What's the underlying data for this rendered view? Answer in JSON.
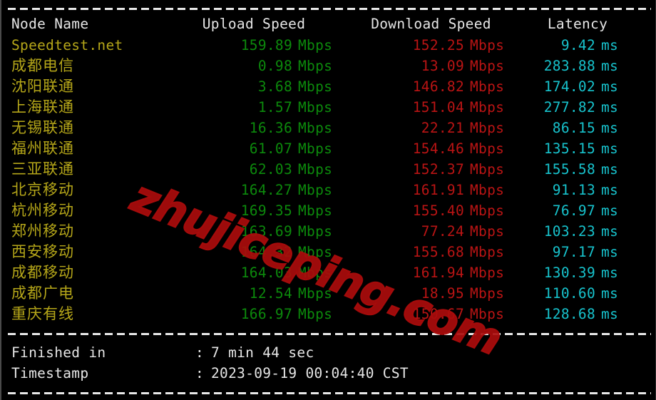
{
  "table": {
    "headers": {
      "node": "Node Name",
      "upload": "Upload Speed",
      "download": "Download Speed",
      "latency": "Latency"
    },
    "units": {
      "speed": "Mbps",
      "latency": "ms"
    },
    "rows": [
      {
        "node": "Speedtest.net",
        "upload": "159.89",
        "download": "152.25",
        "latency": "9.42",
        "cjk": false
      },
      {
        "node": "成都电信",
        "upload": "0.98",
        "download": "13.09",
        "latency": "283.88",
        "cjk": true
      },
      {
        "node": "沈阳联通",
        "upload": "3.68",
        "download": "146.82",
        "latency": "174.02",
        "cjk": true
      },
      {
        "node": "上海联通",
        "upload": "1.57",
        "download": "151.04",
        "latency": "277.82",
        "cjk": true
      },
      {
        "node": "无锡联通",
        "upload": "16.36",
        "download": "22.21",
        "latency": "86.15",
        "cjk": true
      },
      {
        "node": "福州联通",
        "upload": "61.07",
        "download": "154.46",
        "latency": "135.15",
        "cjk": true
      },
      {
        "node": "三亚联通",
        "upload": "62.03",
        "download": "152.37",
        "latency": "155.58",
        "cjk": true
      },
      {
        "node": "北京移动",
        "upload": "164.27",
        "download": "161.91",
        "latency": "91.13",
        "cjk": true
      },
      {
        "node": "杭州移动",
        "upload": "169.35",
        "download": "155.40",
        "latency": "76.97",
        "cjk": true
      },
      {
        "node": "郑州移动",
        "upload": "163.69",
        "download": "77.24",
        "latency": "103.23",
        "cjk": true
      },
      {
        "node": "西安移动",
        "upload": "164.32",
        "download": "155.68",
        "latency": "97.17",
        "cjk": true
      },
      {
        "node": "成都移动",
        "upload": "164.03",
        "download": "161.94",
        "latency": "130.39",
        "cjk": true
      },
      {
        "node": "成都广电",
        "upload": "12.54",
        "download": "18.95",
        "latency": "110.60",
        "cjk": true
      },
      {
        "node": "重庆有线",
        "upload": "166.97",
        "download": "150.67",
        "latency": "128.68",
        "cjk": true
      }
    ]
  },
  "footer": {
    "finished_label": "Finished in",
    "finished_colon": ":",
    "finished_value": "7 min 44 sec",
    "timestamp_label": "Timestamp",
    "timestamp_colon": ":",
    "timestamp_value": "2023-09-19 00:04:40 CST"
  },
  "watermark": {
    "text": "zhujiceping.com"
  },
  "colors": {
    "background": "#000000",
    "header_text": "#e6e6e6",
    "node_text": "#b5a619",
    "upload_text": "#0c8a0c",
    "download_text": "#ba1414",
    "latency_text": "#17c2cc",
    "separator": "#e8e8e8",
    "watermark": "#aa0c0c"
  }
}
